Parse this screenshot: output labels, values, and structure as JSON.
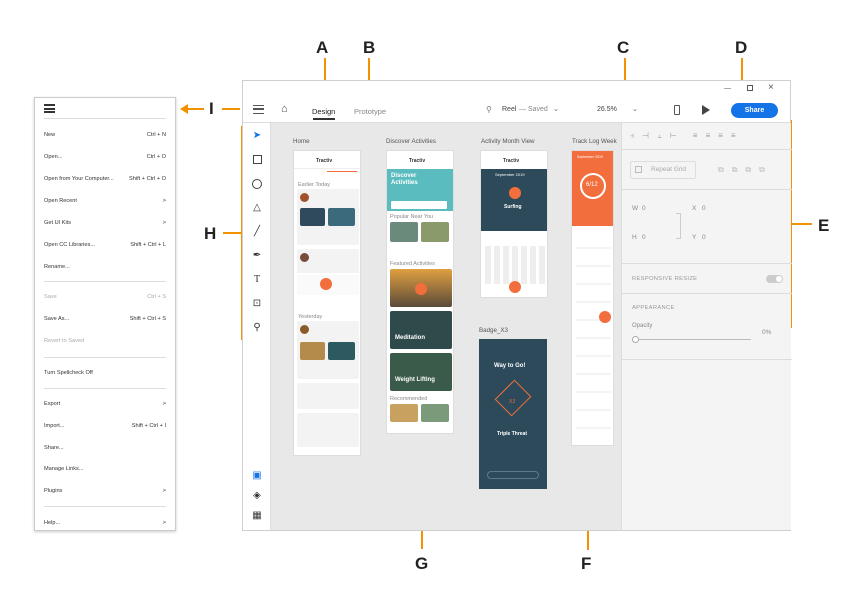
{
  "annotations": {
    "A": "A",
    "B": "B",
    "C": "C",
    "D": "D",
    "E": "E",
    "F": "F",
    "G": "G",
    "H": "H",
    "I": "I"
  },
  "menu": {
    "items": [
      {
        "label": "New",
        "shortcut": "Ctrl + N"
      },
      {
        "label": "Open...",
        "shortcut": "Ctrl + O"
      },
      {
        "label": "Open from Your Computer...",
        "shortcut": "Shift + Ctrl + O"
      },
      {
        "label": "Open Recent",
        "shortcut": ">"
      },
      {
        "label": "Get UI Kits",
        "shortcut": ">"
      },
      {
        "label": "Open CC Libraries...",
        "shortcut": "Shift + Ctrl + L"
      },
      {
        "label": "Rename...",
        "shortcut": ""
      },
      {
        "label": "Save",
        "shortcut": "Ctrl + S"
      },
      {
        "label": "Save As...",
        "shortcut": "Shift + Ctrl + S"
      },
      {
        "label": "Revert to Saved",
        "shortcut": ""
      },
      {
        "label": "Turn Spellcheck Off",
        "shortcut": ""
      },
      {
        "label": "Export",
        "shortcut": ">"
      },
      {
        "label": "Import...",
        "shortcut": "Shift + Ctrl + I"
      },
      {
        "label": "Share...",
        "shortcut": ""
      },
      {
        "label": "Manage Links...",
        "shortcut": ""
      },
      {
        "label": "Plugins",
        "shortcut": ">"
      },
      {
        "label": "Help...",
        "shortcut": ">"
      }
    ]
  },
  "topbar": {
    "design": "Design",
    "prototype": "Prototype",
    "doc_name": "Reel",
    "doc_status": "— Saved",
    "zoom": "26.5%",
    "share": "Share"
  },
  "artboards": {
    "home": "Home",
    "discover": "Discover Activities",
    "month": "Activity Month View",
    "tracklog": "Track Log Week",
    "badge": "Badge_X3"
  },
  "mock": {
    "app_name": "Tractiv",
    "discover_title": "Discover Activities",
    "surfing": "Surfing",
    "meditation": "Meditation",
    "weightlifting": "Weight Lifting",
    "way_to_go": "Way to Go!",
    "triple_threat": "Triple Threat",
    "x3": "X3",
    "earlier_today": "Earlier Today",
    "yesterday": "Yesterday",
    "popular": "Popular Near You",
    "featured": "Featured Activities",
    "recommended": "Recommended",
    "sept": "September 2019",
    "six_twelve": "6/12"
  },
  "props": {
    "repeat_grid": "Repeat Grid",
    "w": "W",
    "w_val": "0",
    "x": "X",
    "x_val": "0",
    "h": "H",
    "h_val": "0",
    "y": "Y",
    "y_val": "0",
    "responsive_resize": "RESPONSIVE RESIZE",
    "appearance": "APPEARANCE",
    "opacity": "Opacity",
    "opacity_val": "0%"
  },
  "colors": {
    "accent": "#f39200",
    "share": "#1473e6",
    "orange": "#f26e3d",
    "teal": "#5bbcc0",
    "navy": "#2c4a5a"
  }
}
